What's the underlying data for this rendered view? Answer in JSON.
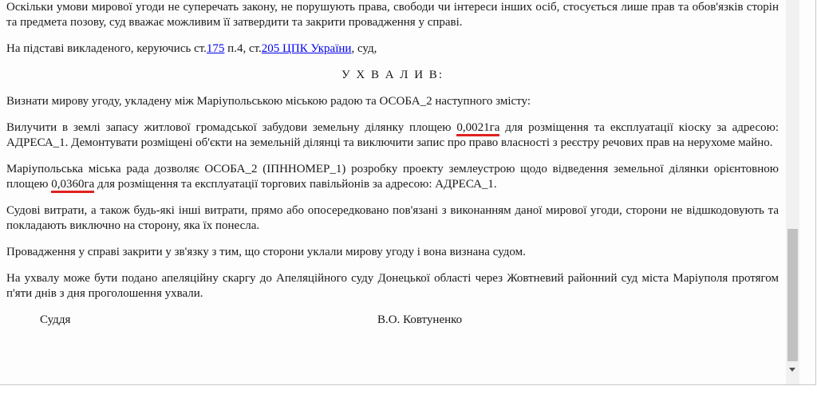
{
  "document": {
    "p1": "Оскільки умови мирової угоди не суперечать закону, не порушують права, свободи чи інтереси інших осіб, стосується лише прав та обов'язків сторін та предмета позову, суд вважає можливим її затвердити та закрити провадження у справі.",
    "p2": {
      "prefix": "На підставі викладеного, керуючись ст.",
      "link1": "175",
      "middle": " п.4, ст.",
      "link2": "205 ЦПК України",
      "suffix": ", суд,"
    },
    "heading": "У Х В А Л И В:",
    "p3": "Визнати мирову угоду, укладену між Маріупольською міською радою та ОСОБА_2 наступного змісту:",
    "p4": {
      "prefix": "Вилучити в землі запасу житлової громадської забудови земельну ділянку площею ",
      "area": "0,0021га",
      "suffix": " для розміщення та експлуатації кіоску за адресою: АДРЕСА_1. Демонтувати розміщені об'єкти на земельній ділянці та виключити запис про право власності з реєстру речових прав на нерухоме майно."
    },
    "p5": {
      "prefix": "Маріупольська міська рада дозволяє ОСОБА_2 (ІПННОМЕР_1) розробку проекту землеустрою щодо відведення земельної ділянки орієнтовною площею ",
      "area": "0,0360га",
      "suffix": " для розміщення та експлуатації торгових павільйонів за адресою: АДРЕСА_1."
    },
    "p6": "Судові витрати, а також будь-які інші витрати, прямо або опосередковано пов'язані з виконанням даної мирової угоди, сторони не відшкодовують та покладають виключно на сторону, яка їх понесла.",
    "p7": "Провадження у справі закрити у зв'язку з тим, що сторони уклали мирову угоду і вона визнана судом.",
    "p8": "На ухвалу може бути подано апеляційну скаргу до Апеляційного суду Донецької області через Жовтневий районний суд міста Маріуполя протягом п'яти днів з дня проголошення ухвали.",
    "signature": {
      "role": "Суддя",
      "name": "В.О. Ковтуненко"
    }
  },
  "colors": {
    "link": "#0000ee",
    "highlight_underline": "#e0211f"
  }
}
